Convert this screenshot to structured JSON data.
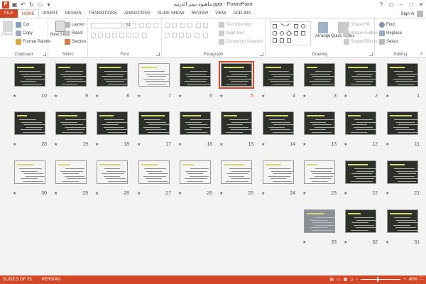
{
  "window": {
    "title": "ماهيوه نيمر الذرتيه.pptx - PowerPoint",
    "sign_in": "Sign in"
  },
  "tabs": [
    "FILE",
    "HOME",
    "INSERT",
    "DESIGN",
    "TRANSITIONS",
    "ANIMATIONS",
    "SLIDE SHOW",
    "REVIEW",
    "VIEW",
    "ADD-INS"
  ],
  "active_tab": "HOME",
  "ribbon": {
    "clipboard": {
      "paste": "Paste",
      "cut": "Cut",
      "copy": "Copy",
      "format_painter": "Format Painter",
      "label": "Clipboard"
    },
    "slides": {
      "new_slide": "New Slide",
      "layout": "Layout",
      "reset": "Reset",
      "section": "Section",
      "label": "Slides"
    },
    "font": {
      "size": "24",
      "label": "Font"
    },
    "paragraph": {
      "text_direction": "Text Direction",
      "align_text": "Align Text",
      "convert_smartart": "Convert to SmartArt",
      "label": "Paragraph"
    },
    "drawing": {
      "arrange": "Arrange",
      "quick_styles": "Quick Styles",
      "shape_fill": "Shape Fill",
      "shape_outline": "Shape Outline",
      "shape_effects": "Shape Effects",
      "label": "Drawing"
    },
    "editing": {
      "find": "Find",
      "replace": "Replace",
      "select": "Select",
      "label": "Editing"
    }
  },
  "slides": {
    "total": 33,
    "selected": 5,
    "rows": [
      [
        10,
        9,
        8,
        7,
        6,
        5,
        4,
        3,
        2,
        1
      ],
      [
        20,
        19,
        18,
        17,
        16,
        15,
        14,
        13,
        12,
        11
      ],
      [
        30,
        29,
        28,
        27,
        26,
        25,
        24,
        23,
        22,
        21
      ],
      [
        33,
        32,
        31
      ]
    ],
    "light_slides": [
      7,
      23,
      24,
      25,
      26,
      27,
      28,
      29,
      30
    ],
    "photo_slides": [
      33
    ],
    "star": "★"
  },
  "status": {
    "slide_info": "SLIDE 5 OF 33",
    "language": "PERSIAN",
    "zoom": "40%",
    "zoom_fraction": 0.4
  },
  "colors": {
    "accent": "#d24726",
    "thumb_dark": "#2d3129"
  }
}
